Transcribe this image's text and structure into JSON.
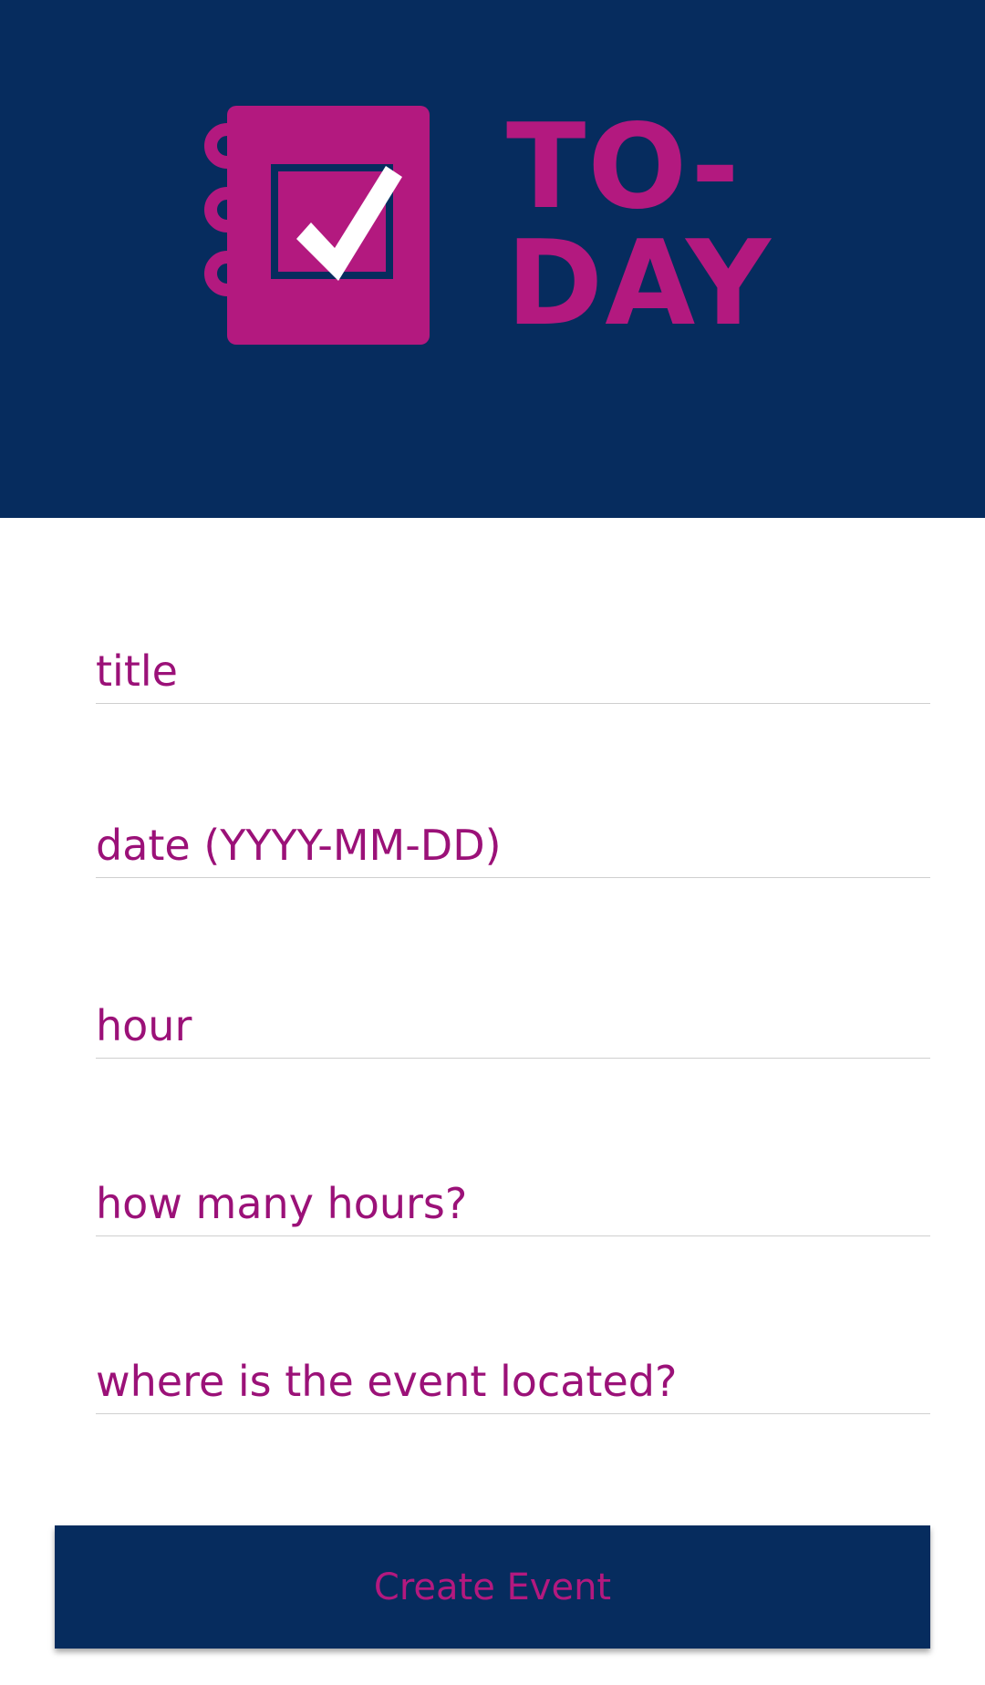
{
  "header": {
    "logo": {
      "icon": "notebook-checkmark-icon",
      "text_line1": "TO-",
      "text_line2": "DAY",
      "brand_color": "#b3197f",
      "background_color": "#062c5e"
    }
  },
  "form": {
    "fields": [
      {
        "placeholder": "title"
      },
      {
        "placeholder": "date (YYYY-MM-DD)"
      },
      {
        "placeholder": "hour"
      },
      {
        "placeholder": "how many hours?"
      },
      {
        "placeholder": "where is the event located?"
      }
    ],
    "text_color": "#9b1178"
  },
  "actions": {
    "create_label": "Create Event"
  }
}
